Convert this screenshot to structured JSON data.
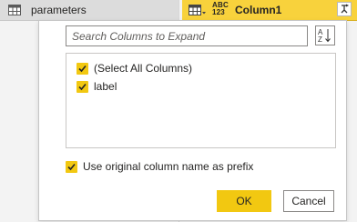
{
  "query_pane": {
    "query_name": "parameters",
    "icon": "table-icon"
  },
  "column_header": {
    "type_top": "ABC",
    "type_bottom": "123",
    "name": "Column1",
    "expand_icon": "expand-columns-icon"
  },
  "expand_popup": {
    "search_placeholder": "Search Columns to Expand",
    "sort_icon": "sort-az-icon",
    "columns": [
      {
        "label": "(Select All Columns)",
        "checked": true
      },
      {
        "label": "label",
        "checked": true
      }
    ],
    "prefix_option": {
      "label": "Use original column name as prefix",
      "checked": true
    },
    "ok_label": "OK",
    "cancel_label": "Cancel"
  },
  "colors": {
    "accent": "#f2c811",
    "header_bg": "#f8d23c",
    "border": "#8a8886"
  }
}
